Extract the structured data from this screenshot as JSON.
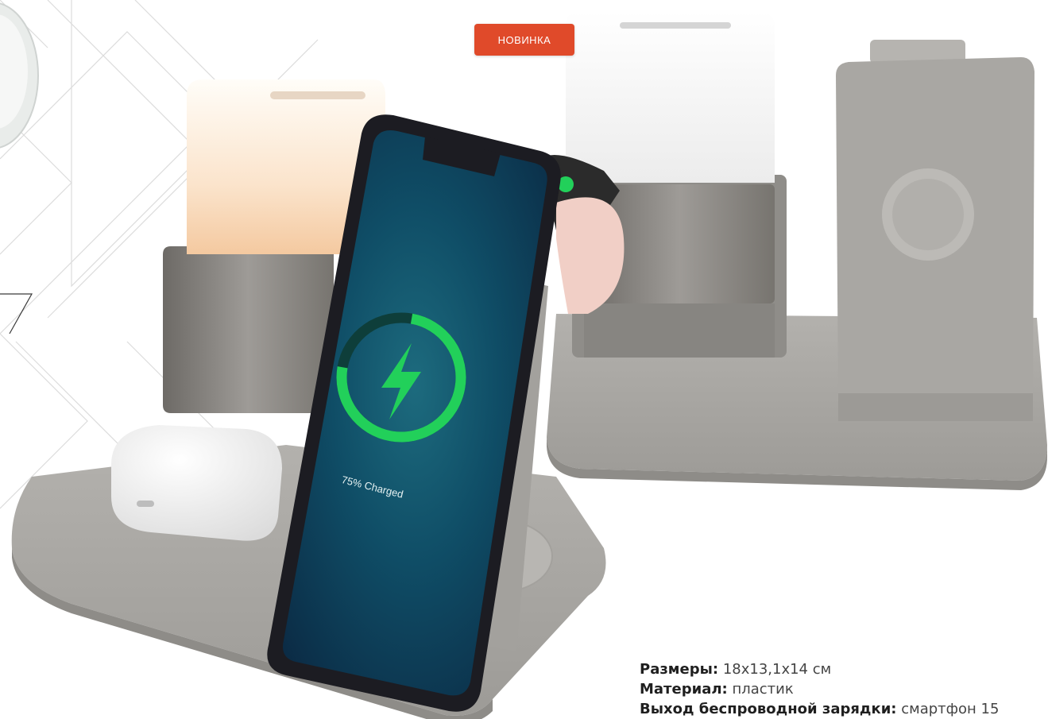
{
  "badge": {
    "label": "НОВИНКА",
    "color": "#e04a2a"
  },
  "phone_screen": {
    "status_text": "75% Charged",
    "charge_percent": 75,
    "ring_color": "#22d05a"
  },
  "specs": [
    {
      "label": "Размеры:",
      "value": " 18x13,1x14 см"
    },
    {
      "label": "Материал:",
      "value": " пластик"
    },
    {
      "label": "Выход беспроводной зарядки:",
      "value": " смартфон 15"
    }
  ],
  "icons": [
    "lightning-bolt-icon",
    "wireless-charging-icon"
  ],
  "colors": {
    "base_gray": "#a9a7a3",
    "lamp_glow": "#fbe4cc",
    "watch_band": "#f1cfc6"
  }
}
